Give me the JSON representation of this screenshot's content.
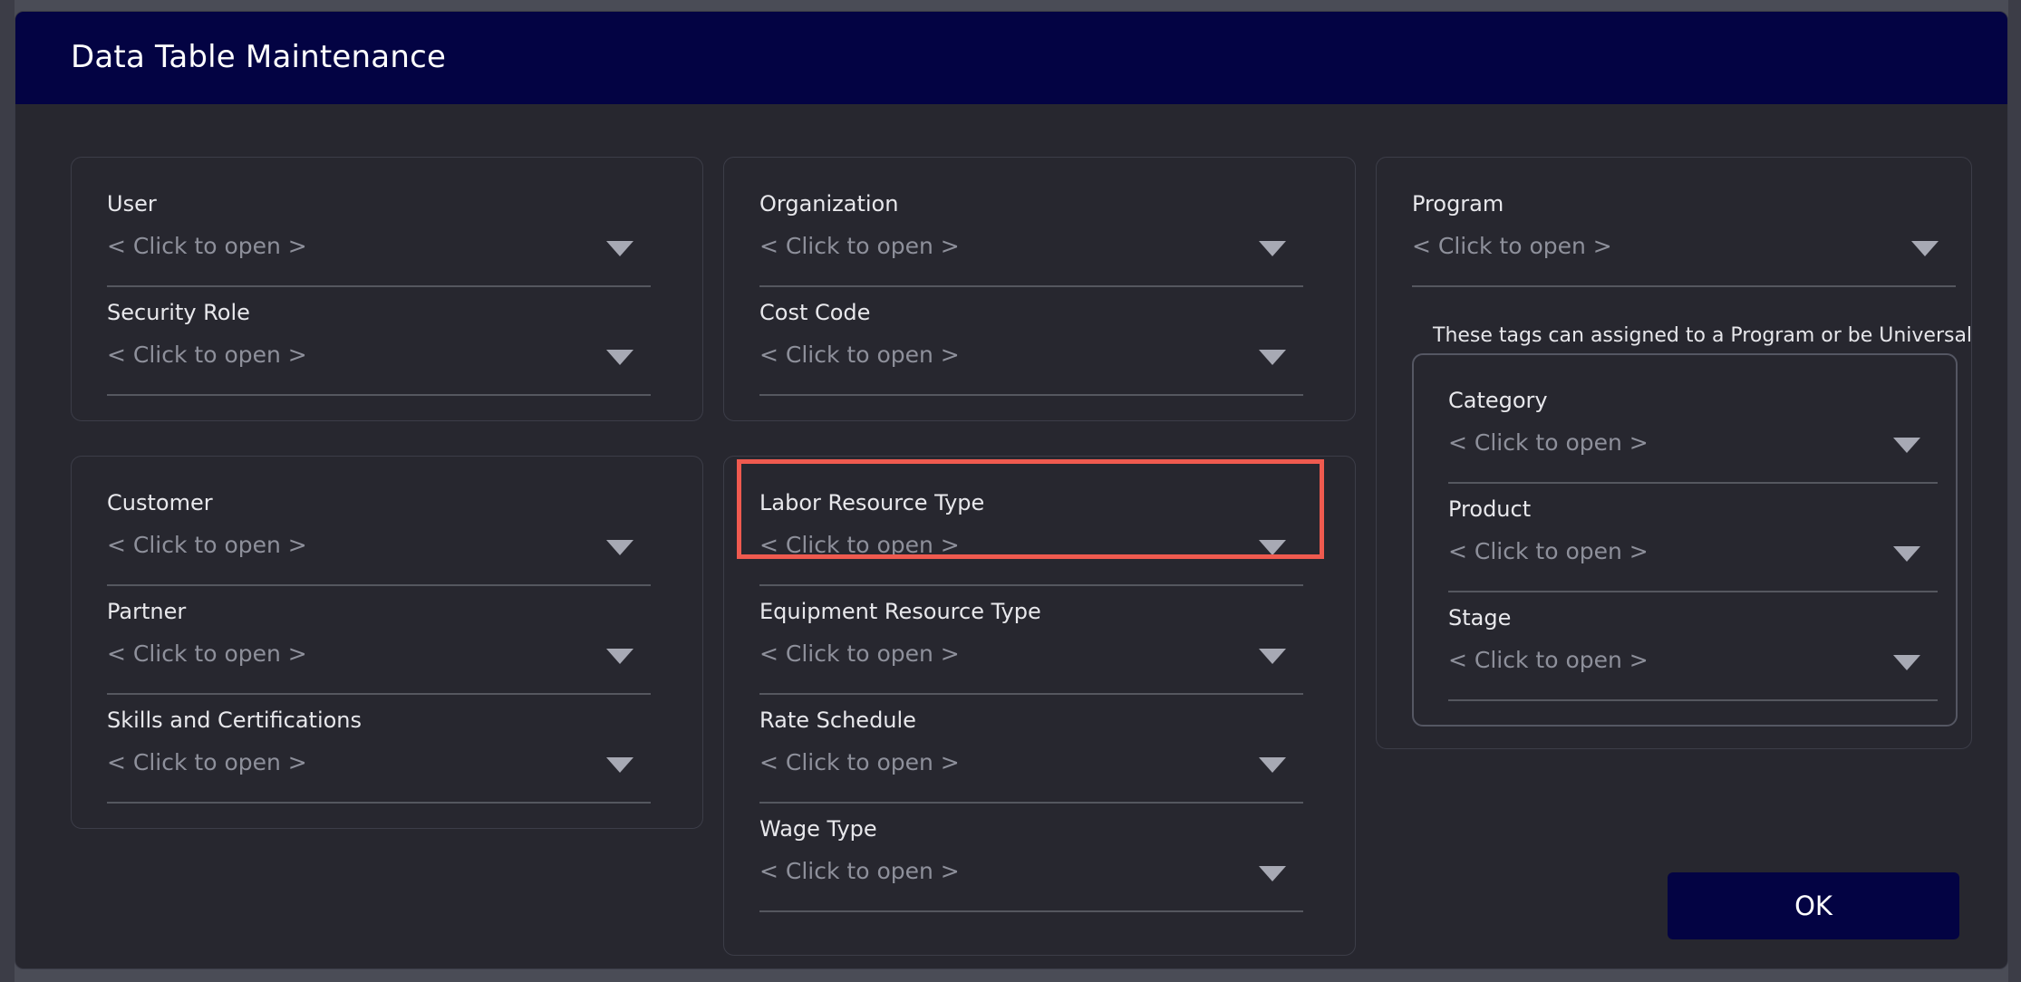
{
  "dialog": {
    "title": "Data Table Maintenance"
  },
  "groups": {
    "user_security": {
      "fields": [
        {
          "label": "User",
          "value": "< Click to open >"
        },
        {
          "label": "Security Role",
          "value": "< Click to open >"
        }
      ]
    },
    "customer_partner": {
      "fields": [
        {
          "label": "Customer",
          "value": "< Click to open >"
        },
        {
          "label": "Partner",
          "value": "< Click to open >"
        },
        {
          "label": "Skills and Certifications",
          "value": "< Click to open >"
        }
      ]
    },
    "organization_cost": {
      "fields": [
        {
          "label": "Organization",
          "value": "< Click to open >"
        },
        {
          "label": "Cost Code",
          "value": "< Click to open >"
        }
      ]
    },
    "resources": {
      "fields": [
        {
          "label": "Labor Resource Type",
          "value": "< Click to open >"
        },
        {
          "label": "Equipment Resource Type",
          "value": "< Click to open >"
        },
        {
          "label": "Rate Schedule",
          "value": "< Click to open >"
        },
        {
          "label": "Wage Type",
          "value": "< Click to open >"
        }
      ]
    },
    "program": {
      "fields": [
        {
          "label": "Program",
          "value": "< Click to open >"
        }
      ],
      "tags_note": "These tags can assigned to a Program or be Universal",
      "tags": [
        {
          "label": "Category",
          "value": "< Click to open >"
        },
        {
          "label": "Product",
          "value": "< Click to open >"
        },
        {
          "label": "Stage",
          "value": "< Click to open >"
        }
      ]
    }
  },
  "ok_label": "OK",
  "colors": {
    "header": "#030343",
    "dialog_bg": "#27272f",
    "highlight": "#ef5a4f"
  }
}
